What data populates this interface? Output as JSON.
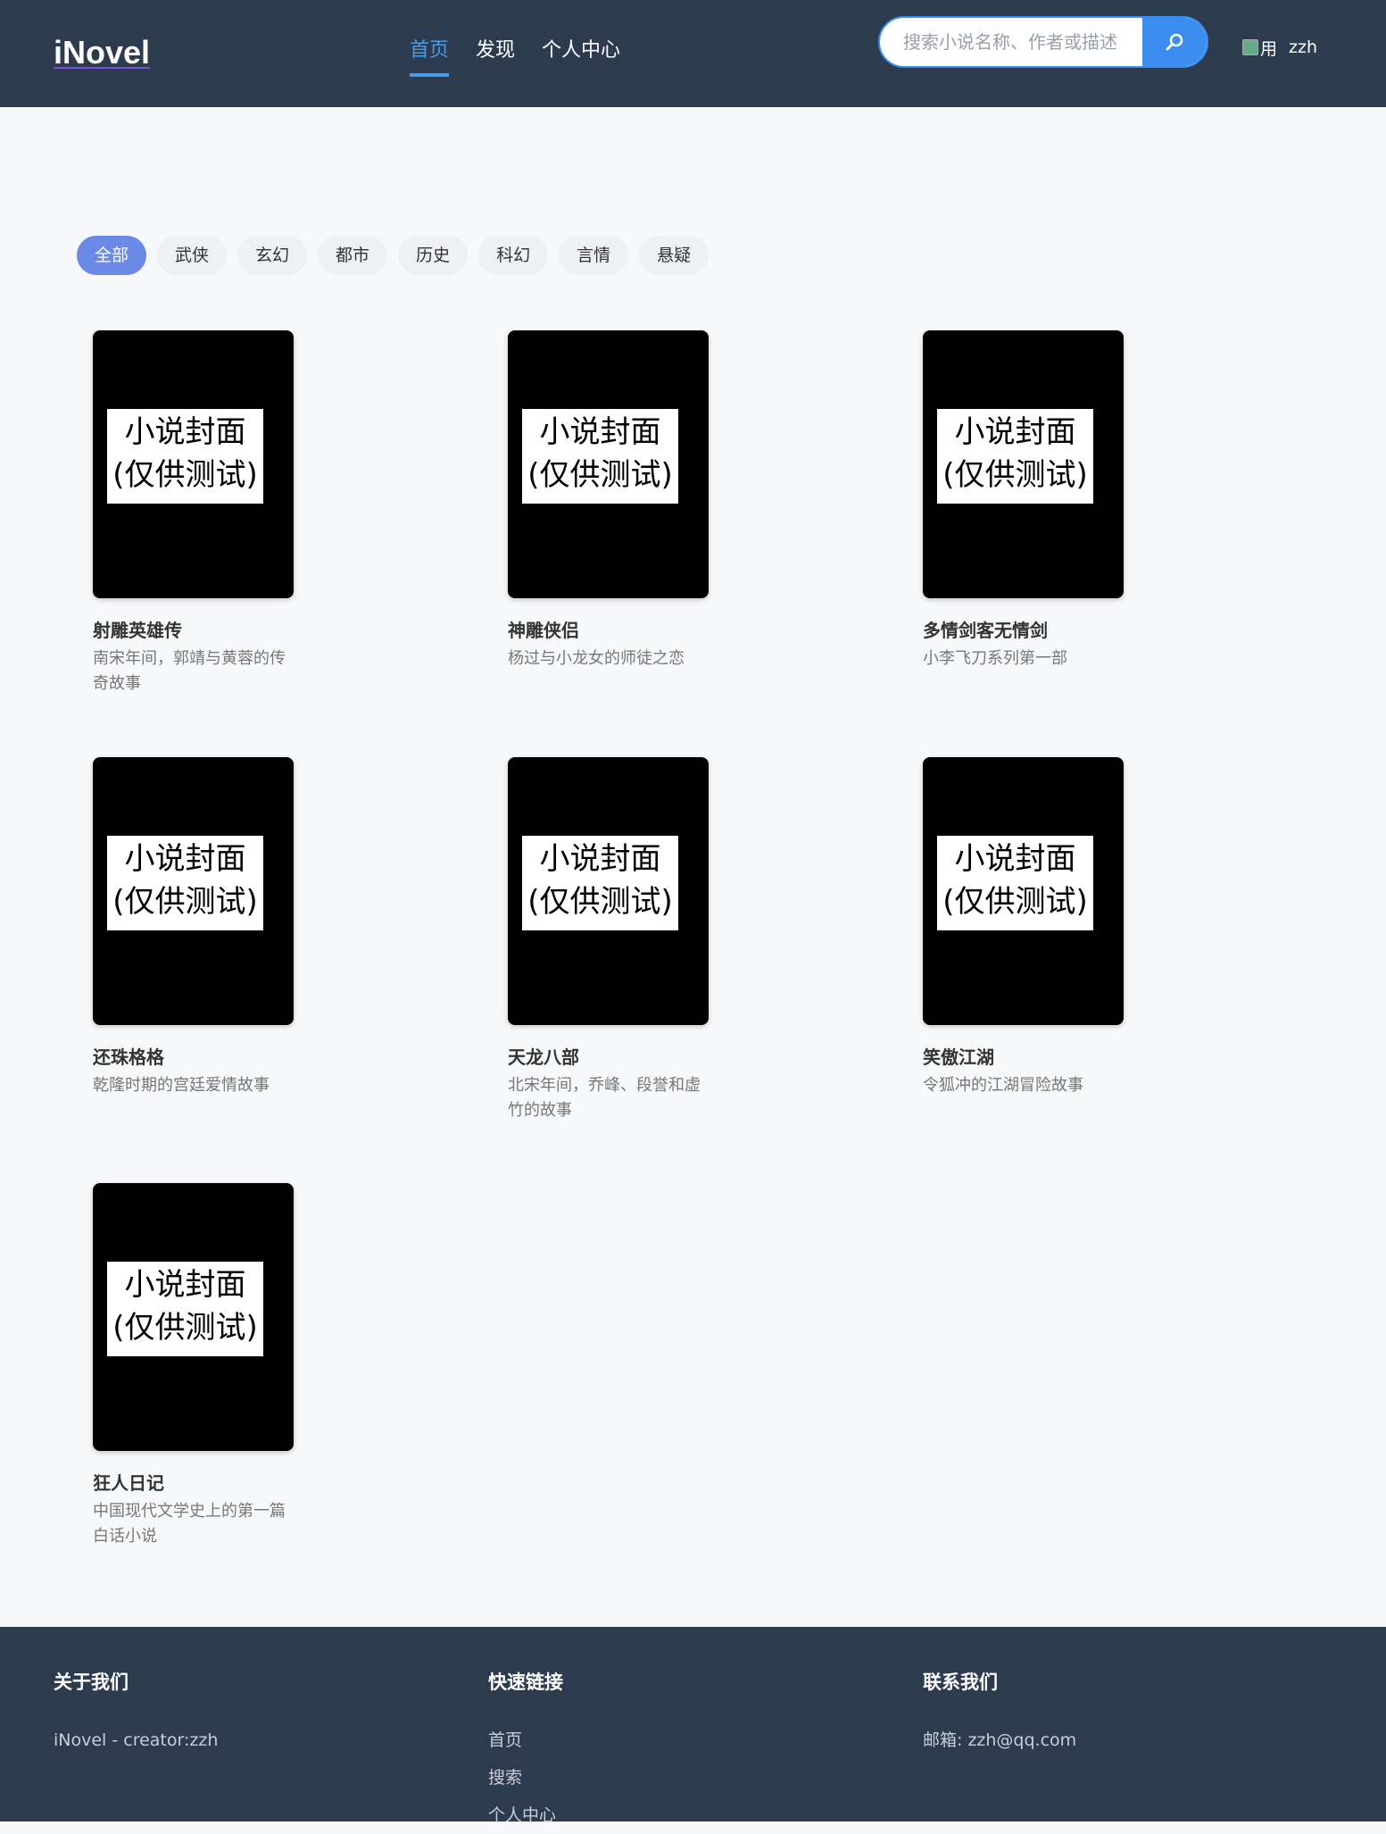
{
  "header": {
    "logo": "iNovel",
    "nav": [
      {
        "label": "首页",
        "active": true
      },
      {
        "label": "发现",
        "active": false
      },
      {
        "label": "个人中心",
        "active": false
      }
    ],
    "search": {
      "placeholder": "搜索小说名称、作者或描述",
      "button_icon": "search-icon"
    },
    "user": {
      "avatar_alt": "用",
      "name": "zzh"
    }
  },
  "filters": [
    "全部",
    "武侠",
    "玄幻",
    "都市",
    "历史",
    "科幻",
    "言情",
    "悬疑"
  ],
  "active_filter": "全部",
  "cover_text": {
    "line1": "小说封面",
    "line2": "(仅供测试)"
  },
  "books": [
    {
      "title": "射雕英雄传",
      "desc": "南宋年间，郭靖与黄蓉的传奇故事"
    },
    {
      "title": "神雕侠侣",
      "desc": "杨过与小龙女的师徒之恋"
    },
    {
      "title": "多情剑客无情剑",
      "desc": "小李飞刀系列第一部"
    },
    {
      "title": "还珠格格",
      "desc": "乾隆时期的宫廷爱情故事"
    },
    {
      "title": "天龙八部",
      "desc": "北宋年间，乔峰、段誉和虚竹的故事"
    },
    {
      "title": "笑傲江湖",
      "desc": "令狐冲的江湖冒险故事"
    },
    {
      "title": "狂人日记",
      "desc": "中国现代文学史上的第一篇白话小说"
    }
  ],
  "footer": {
    "about": {
      "heading": "关于我们",
      "text": "iNovel - creator:zzh"
    },
    "links": {
      "heading": "快速链接",
      "items": [
        "首页",
        "搜索",
        "个人中心"
      ]
    },
    "contact": {
      "heading": "联系我们",
      "text": "邮箱: zzh@qq.com"
    }
  },
  "colors": {
    "header_bg": "#2d3b4f",
    "accent": "#4b9ce8",
    "chip_active": "#6b8ae8",
    "search_btn": "#3b8ef0"
  }
}
